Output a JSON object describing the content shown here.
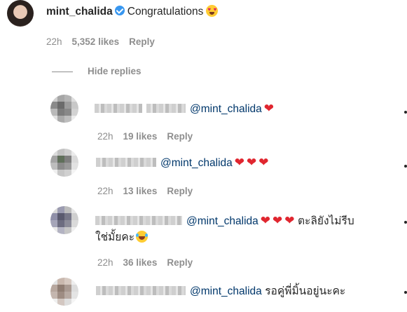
{
  "main_comment": {
    "username": "mint_chalida",
    "text": "Congratulations",
    "emoji": "heart-eyes-emoji",
    "time": "22h",
    "likes": "5,352 likes",
    "reply": "Reply",
    "verified_icon": "verified-badge-icon"
  },
  "hide_replies": "Hide replies",
  "replies": [
    {
      "mention": "@mint_chalida",
      "text": "",
      "time": "22h",
      "likes": "19 likes",
      "reply": "Reply",
      "hearts": 1
    },
    {
      "mention": "@mint_chalida",
      "text": "",
      "time": "22h",
      "likes": "13 likes",
      "reply": "Reply",
      "hearts": 3
    },
    {
      "mention": "@mint_chalida",
      "text": "ตะลิยังไม่รีบ",
      "text2": "ใช่มั้ยคะ",
      "time": "22h",
      "likes": "36 likes",
      "reply": "Reply",
      "hearts": 3
    },
    {
      "mention": "@mint_chalida",
      "text": "รอคู่พี่มิ้นอยู่นะคะ",
      "hearts": 0
    }
  ],
  "colors": {
    "mention": "#00376b",
    "meta": "#8e8e8e",
    "heart": "#e0262f",
    "verified": "#3897f0"
  }
}
